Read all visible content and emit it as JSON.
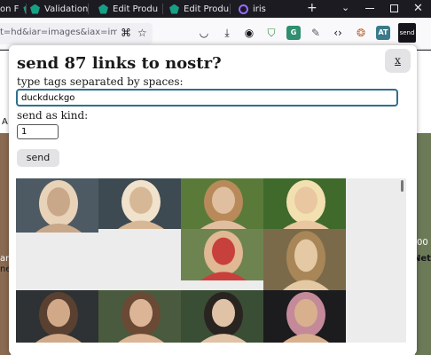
{
  "tabs": [
    {
      "label": "on F",
      "favicon": "green-gem-icon"
    },
    {
      "label": "Validation F",
      "favicon": "green-gem-icon"
    },
    {
      "label": "Edit Produ",
      "favicon": "green-gem-icon"
    },
    {
      "label": "Edit Produ",
      "favicon": "green-gem-icon"
    },
    {
      "label": "iris",
      "favicon": "iris-ring-icon"
    }
  ],
  "browser": {
    "url": "t=hd&iar=images&iax=imag",
    "new_tab": "+",
    "tab_list": "⌄",
    "close": "✕"
  },
  "toolbar": {
    "ext_badge_a": "AT",
    "ext_badge_send": "send",
    "menu": "≡"
  },
  "background": {
    "left_letter": "A",
    "left_fragment_1": "ar",
    "left_fragment_2": "ne",
    "right_fragment_1": "00",
    "right_fragment_2": "Net"
  },
  "modal": {
    "title": "send 87 links to nostr?",
    "close_label": "x",
    "tags_label": "type tags separated by spaces:",
    "tags_value": "duckduckgo",
    "kind_label": "send as kind:",
    "kind_value": "1",
    "send_label": "send"
  },
  "colors": {
    "accent_border": "#2f6f8f",
    "button_bg": "#e3e3e5",
    "tabbar_bg": "#1c1b22"
  },
  "gallery": {
    "thumbnails": [
      {
        "palette": [
          "#4d5a63",
          "#c9a88a",
          "#e8d3b8"
        ]
      },
      {
        "palette": [
          "#3d4a52",
          "#d7b896",
          "#f0e2cc"
        ]
      },
      {
        "palette": [
          "#5a7a3a",
          "#e0bfa0",
          "#b88a5a"
        ]
      },
      {
        "palette": [
          "#3f6a2c",
          "#e9c7a0",
          "#f2e0b0"
        ]
      },
      {
        "palette": [
          "#6e8450",
          "#c8403c",
          "#e0b894"
        ]
      },
      {
        "palette": [
          "#7a6a4a",
          "#e5c9a5",
          "#a88658"
        ]
      },
      {
        "palette": [
          "#2e3234",
          "#d2a988",
          "#5a4030"
        ]
      },
      {
        "palette": [
          "#4a5a3e",
          "#dcb596",
          "#6a4a34"
        ]
      },
      {
        "palette": [
          "#3a4e36",
          "#e0c2a6",
          "#2a2420"
        ]
      },
      {
        "palette": [
          "#1c1c1e",
          "#d9b08e",
          "#c48a9a"
        ]
      }
    ]
  }
}
